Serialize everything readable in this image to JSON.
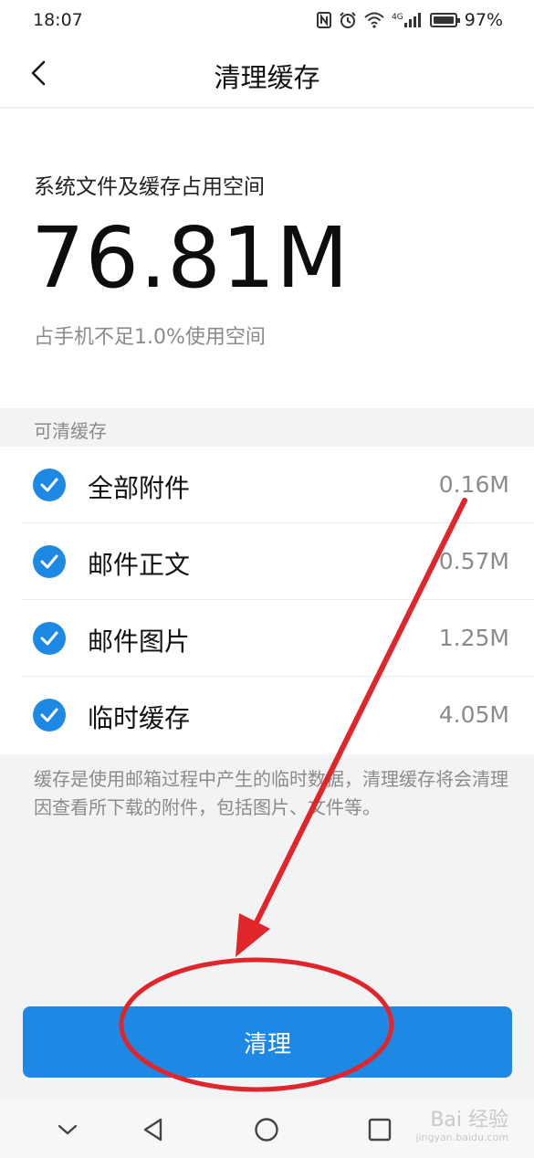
{
  "status_bar": {
    "time": "18:07",
    "network_label": "4G",
    "battery": "97%"
  },
  "header": {
    "title": "清理缓存"
  },
  "summary": {
    "label": "系统文件及缓存占用空间",
    "size": "76.81M",
    "subtext": "占手机不足1.0%使用空间"
  },
  "section": {
    "title": "可清缓存"
  },
  "items": [
    {
      "label": "全部附件",
      "size": "0.16M",
      "checked": true
    },
    {
      "label": "邮件正文",
      "size": "0.57M",
      "checked": true
    },
    {
      "label": "邮件图片",
      "size": "1.25M",
      "checked": true
    },
    {
      "label": "临时缓存",
      "size": "4.05M",
      "checked": true
    }
  ],
  "note": "缓存是使用邮箱过程中产生的临时数据，清理缓存将会清理因查看所下载的附件，包括图片、文件等。",
  "clean_button": "清理",
  "watermark": {
    "brand": "Bai 经验",
    "url": "jingyan.baidu.com"
  },
  "icons": {
    "back": "chevron-left-icon",
    "check": "check-circle-icon",
    "nav_collapse": "chevron-down-icon",
    "nav_back": "triangle-back-icon",
    "nav_home": "circle-home-icon",
    "nav_recent": "square-recent-icon"
  },
  "colors": {
    "accent": "#1e88e5",
    "annotation": "#e53935",
    "background": "#f2f3f5"
  }
}
